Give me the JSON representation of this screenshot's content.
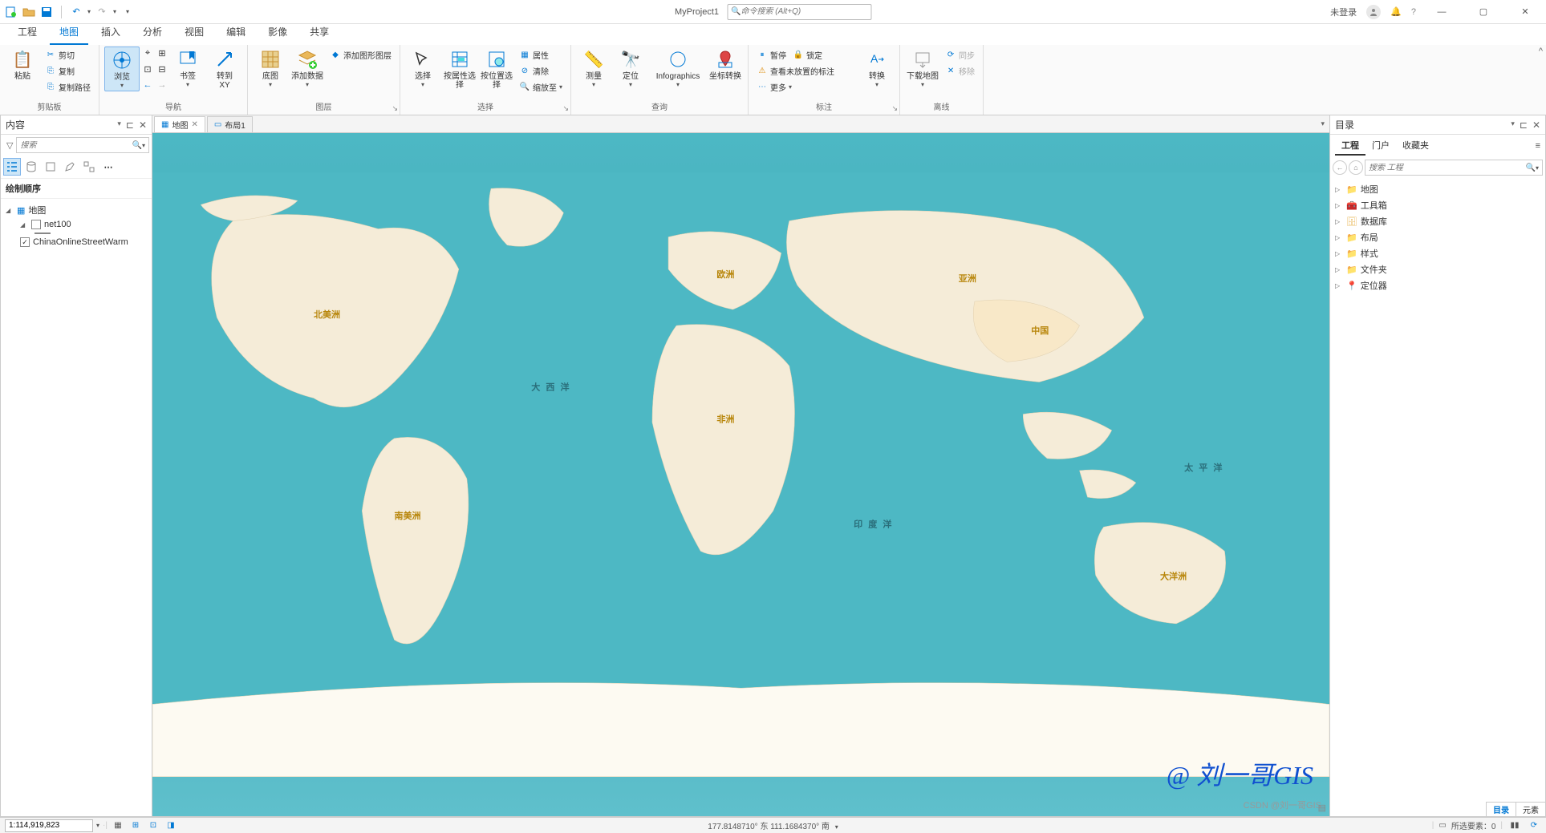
{
  "title": {
    "project_name": "MyProject1",
    "search_placeholder": "命令搜索 (Alt+Q)",
    "login_status": "未登录"
  },
  "ribbon": {
    "tabs": [
      "工程",
      "地图",
      "插入",
      "分析",
      "视图",
      "编辑",
      "影像",
      "共享"
    ],
    "active_tab": 1,
    "groups": {
      "clipboard": {
        "label": "剪贴板",
        "paste": "粘贴",
        "cut": "剪切",
        "copy": "复制",
        "copy_path": "复制路径"
      },
      "navigate": {
        "label": "导航",
        "explore": "浏览",
        "bookmarks": "书签",
        "goto_xy": "转到\nXY"
      },
      "layer": {
        "label": "图层",
        "basemap": "底图",
        "add_data": "添加数据",
        "add_graphics": "添加图形图层"
      },
      "selection": {
        "label": "选择",
        "select": "选择",
        "by_attr": "按属性选择",
        "by_loc": "按位置选择",
        "attributes": "属性",
        "clear": "清除",
        "zoom_to": "缩放至"
      },
      "inquiry": {
        "label": "查询",
        "measure": "测量",
        "locate": "定位",
        "infographics": "Infographics",
        "coord_convert": "坐标转换"
      },
      "labeling": {
        "label": "标注",
        "pause": "暂停",
        "lock": "锁定",
        "view_unplaced": "查看未放置的标注",
        "more": "更多"
      },
      "offline": {
        "label": "离线",
        "convert": "转换",
        "download": "下载地图",
        "sync": "同步",
        "remove": "移除"
      }
    }
  },
  "contents_panel": {
    "title": "内容",
    "search_placeholder": "搜索",
    "section_title": "绘制顺序",
    "map_node": "地图",
    "layer1": "net100",
    "layer1_checked": false,
    "layer2": "ChinaOnlineStreetWarm",
    "layer2_checked": true
  },
  "map_view": {
    "tabs": [
      {
        "label": "地图",
        "closeable": true
      },
      {
        "label": "布局1",
        "closeable": false
      }
    ],
    "labels": {
      "north_america": "北美洲",
      "south_america": "南美洲",
      "europe": "欧洲",
      "africa": "非洲",
      "asia": "亚洲",
      "china": "中国",
      "oceania": "大洋洲",
      "atlantic": "大 西 洋",
      "indian": "印 度 洋",
      "pacific": "太 平 洋"
    }
  },
  "catalog_panel": {
    "title": "目录",
    "tabs": [
      "工程",
      "门户",
      "收藏夹"
    ],
    "active_tab": 0,
    "search_placeholder": "搜索 工程",
    "items": [
      "地图",
      "工具箱",
      "数据库",
      "布局",
      "样式",
      "文件夹",
      "定位器"
    ]
  },
  "statusbar": {
    "scale": "1:114,919,823",
    "coords": "177.8148710° 东 111.1684370° 南",
    "selected": "所选要素：0",
    "bottom_tabs": [
      "目录",
      "元素"
    ],
    "active_bottom": 0
  },
  "watermark": "@ 刘一哥GIS",
  "csdn": "CSDN @刘一哥GIS"
}
